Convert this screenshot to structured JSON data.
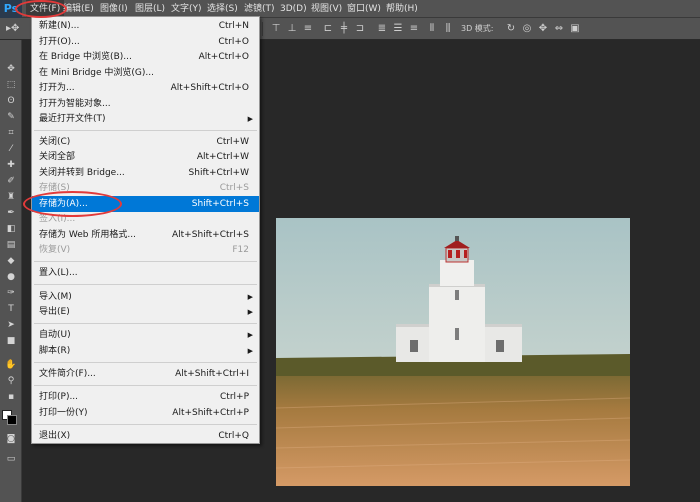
{
  "app": {
    "logo": "Ps"
  },
  "menubar": {
    "items": [
      {
        "label": "文件(F)"
      },
      {
        "label": "编辑(E)"
      },
      {
        "label": "图像(I)"
      },
      {
        "label": "图层(L)"
      },
      {
        "label": "文字(Y)"
      },
      {
        "label": "选择(S)"
      },
      {
        "label": "滤镜(T)"
      },
      {
        "label": "3D(D)"
      },
      {
        "label": "视图(V)"
      },
      {
        "label": "窗口(W)"
      },
      {
        "label": "帮助(H)"
      }
    ]
  },
  "options_bar": {
    "mode_label": "3D 模式:"
  },
  "file_menu": {
    "items": [
      {
        "label": "新建(N)...",
        "shortcut": "Ctrl+N"
      },
      {
        "label": "打开(O)...",
        "shortcut": "Ctrl+O"
      },
      {
        "label": "在 Bridge 中浏览(B)...",
        "shortcut": "Alt+Ctrl+O"
      },
      {
        "label": "在 Mini Bridge 中浏览(G)...",
        "shortcut": ""
      },
      {
        "label": "打开为...",
        "shortcut": "Alt+Shift+Ctrl+O"
      },
      {
        "label": "打开为智能对象...",
        "shortcut": ""
      },
      {
        "label": "最近打开文件(T)",
        "shortcut": ""
      },
      {
        "label": "关闭(C)",
        "shortcut": "Ctrl+W"
      },
      {
        "label": "关闭全部",
        "shortcut": "Alt+Ctrl+W"
      },
      {
        "label": "关闭并转到 Bridge...",
        "shortcut": "Shift+Ctrl+W"
      },
      {
        "label": "存储(S)",
        "shortcut": "Ctrl+S"
      },
      {
        "label": "存储为(A)...",
        "shortcut": "Shift+Ctrl+S"
      },
      {
        "label": "签入(I)...",
        "shortcut": ""
      },
      {
        "label": "存储为 Web 所用格式...",
        "shortcut": "Alt+Shift+Ctrl+S"
      },
      {
        "label": "恢复(V)",
        "shortcut": "F12"
      },
      {
        "label": "置入(L)...",
        "shortcut": ""
      },
      {
        "label": "导入(M)",
        "shortcut": ""
      },
      {
        "label": "导出(E)",
        "shortcut": ""
      },
      {
        "label": "自动(U)",
        "shortcut": ""
      },
      {
        "label": "脚本(R)",
        "shortcut": ""
      },
      {
        "label": "文件简介(F)...",
        "shortcut": "Alt+Shift+Ctrl+I"
      },
      {
        "label": "打印(P)...",
        "shortcut": "Ctrl+P"
      },
      {
        "label": "打印一份(Y)",
        "shortcut": "Alt+Shift+Ctrl+P"
      },
      {
        "label": "退出(X)",
        "shortcut": "Ctrl+Q"
      }
    ]
  },
  "colors": {
    "selection": "#0078d7",
    "annotation": "#e23a3a",
    "menu_bg": "#f0f0f0",
    "chrome": "#535353",
    "workspace": "#282828"
  }
}
